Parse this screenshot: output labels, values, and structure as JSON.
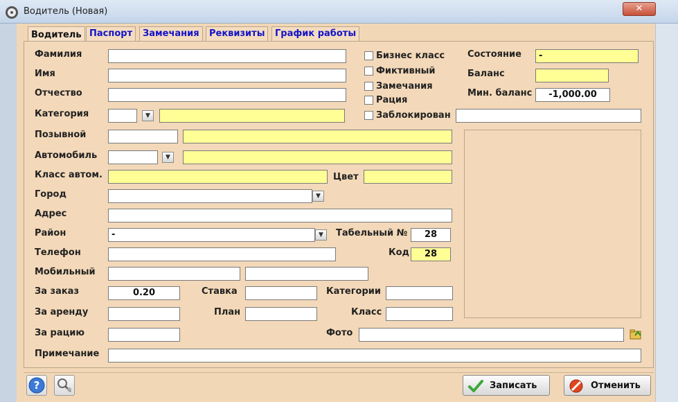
{
  "window": {
    "title": "Водитель  (Новая)",
    "close": "✕"
  },
  "tabs": [
    "Водитель",
    "Паспорт",
    "Замечания",
    "Реквизиты",
    "График работы"
  ],
  "labels": {
    "familiya": "Фамилия",
    "imya": "Имя",
    "otchestvo": "Отчество",
    "kategoriya": "Категория",
    "pozyvnoy": "Позывной",
    "avtomobil": "Автомобиль",
    "klass_avtom": "Класс автом.",
    "cvet": "Цвет",
    "gorod": "Город",
    "adres": "Адрес",
    "rayon": "Район",
    "tabelny": "Табельный №",
    "telefon": "Телефон",
    "kod": "Код",
    "mobilny": "Мобильный",
    "za_zakaz": "За заказ",
    "stavka": "Ставка",
    "kategorii": "Категории",
    "za_arendu": "За аренду",
    "plan": "План",
    "klass": "Класс",
    "za_raciyu": "За рацию",
    "foto": "Фото",
    "primechanie": "Примечание",
    "sostoyanie": "Состояние",
    "balans": "Баланс",
    "min_balans": "Мин. баланс"
  },
  "checkboxes": {
    "biznes": "Бизнес класс",
    "fiktivny": "Фиктивный",
    "zamechaniya": "Замечания",
    "raciya": "Рация",
    "zablokirovan": "Заблокирован"
  },
  "values": {
    "sostoyanie": "-",
    "balans": "",
    "min_balans": "-1,000.00",
    "rayon": "-",
    "tabelny": "28",
    "kod": "28",
    "za_zakaz": "0.20"
  },
  "buttons": {
    "save": "Записать",
    "cancel": "Отменить"
  },
  "colors": {
    "panel": "#f3d9b9",
    "required_field": "#ffff96",
    "tab_text": "#1414c8"
  }
}
